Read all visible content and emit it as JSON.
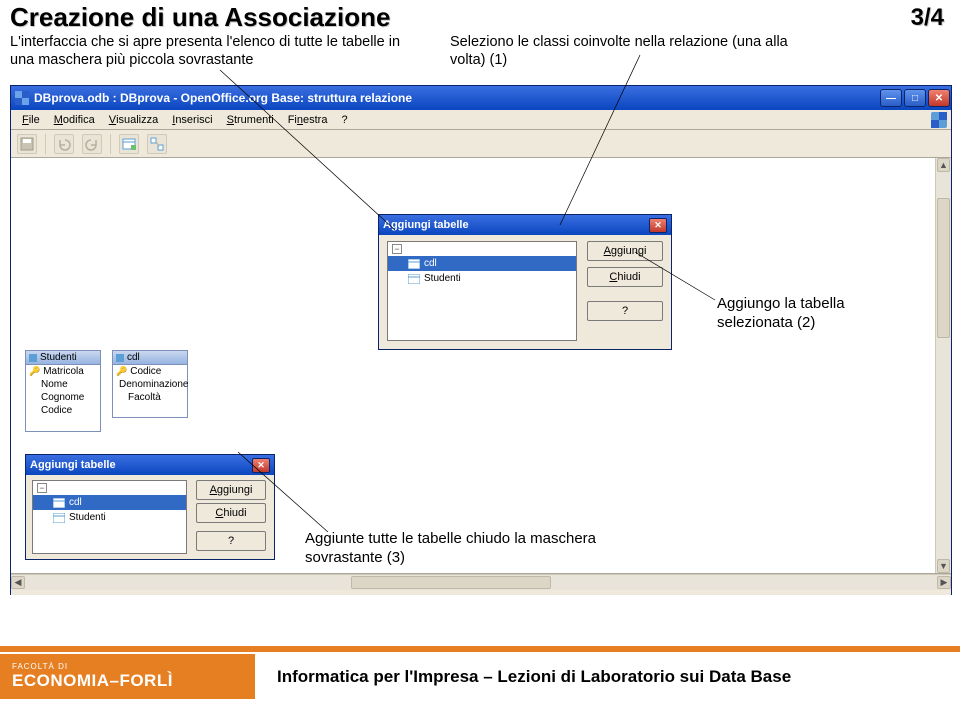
{
  "slide": {
    "title": "Creazione di una Associazione",
    "caption_left": "L'interfaccia che si apre presenta l'elenco di tutte le tabelle in una maschera più piccola sovrastante",
    "caption_right": "Seleziono le classi coinvolte nella relazione (una alla volta) (1)",
    "pager": "3/4",
    "annotation2": "Aggiungo la tabella selezionata (2)",
    "annotation3": "Aggiunte tutte le tabelle chiudo la maschera sovrastante (3)"
  },
  "window": {
    "title": "DBprova.odb : DBprova - OpenOffice.org Base: struttura relazione",
    "menus": {
      "file": "File",
      "modifica": "Modifica",
      "visualizza": "Visualizza",
      "inserisci": "Inserisci",
      "strumenti": "Strumenti",
      "finestra": "Finestra",
      "help": "?"
    }
  },
  "canvas_tables": {
    "studenti": {
      "name": "Studenti",
      "fields": [
        "Matricola",
        "Nome",
        "Cognome",
        "Codice"
      ]
    },
    "cdl": {
      "name": "cdl",
      "fields": [
        "Codice",
        "Denominazione",
        "Facoltà"
      ]
    }
  },
  "dialog_main": {
    "title": "Aggiungi tabelle",
    "items": [
      "cdl",
      "Studenti"
    ],
    "buttons": {
      "aggiungi": "Aggiungi",
      "chiudi": "Chiudi",
      "help": "?"
    }
  },
  "dialog_small": {
    "title": "Aggiungi tabelle",
    "items": [
      "cdl",
      "Studenti"
    ],
    "buttons": {
      "aggiungi": "Aggiungi",
      "chiudi": "Chiudi",
      "help": "?"
    }
  },
  "footer": {
    "facolta": "FACOLTÀ DI",
    "brand": "ECONOMIA–FORLÌ",
    "course": "Informatica per l'Impresa – Lezioni di Laboratorio sui Data Base"
  }
}
